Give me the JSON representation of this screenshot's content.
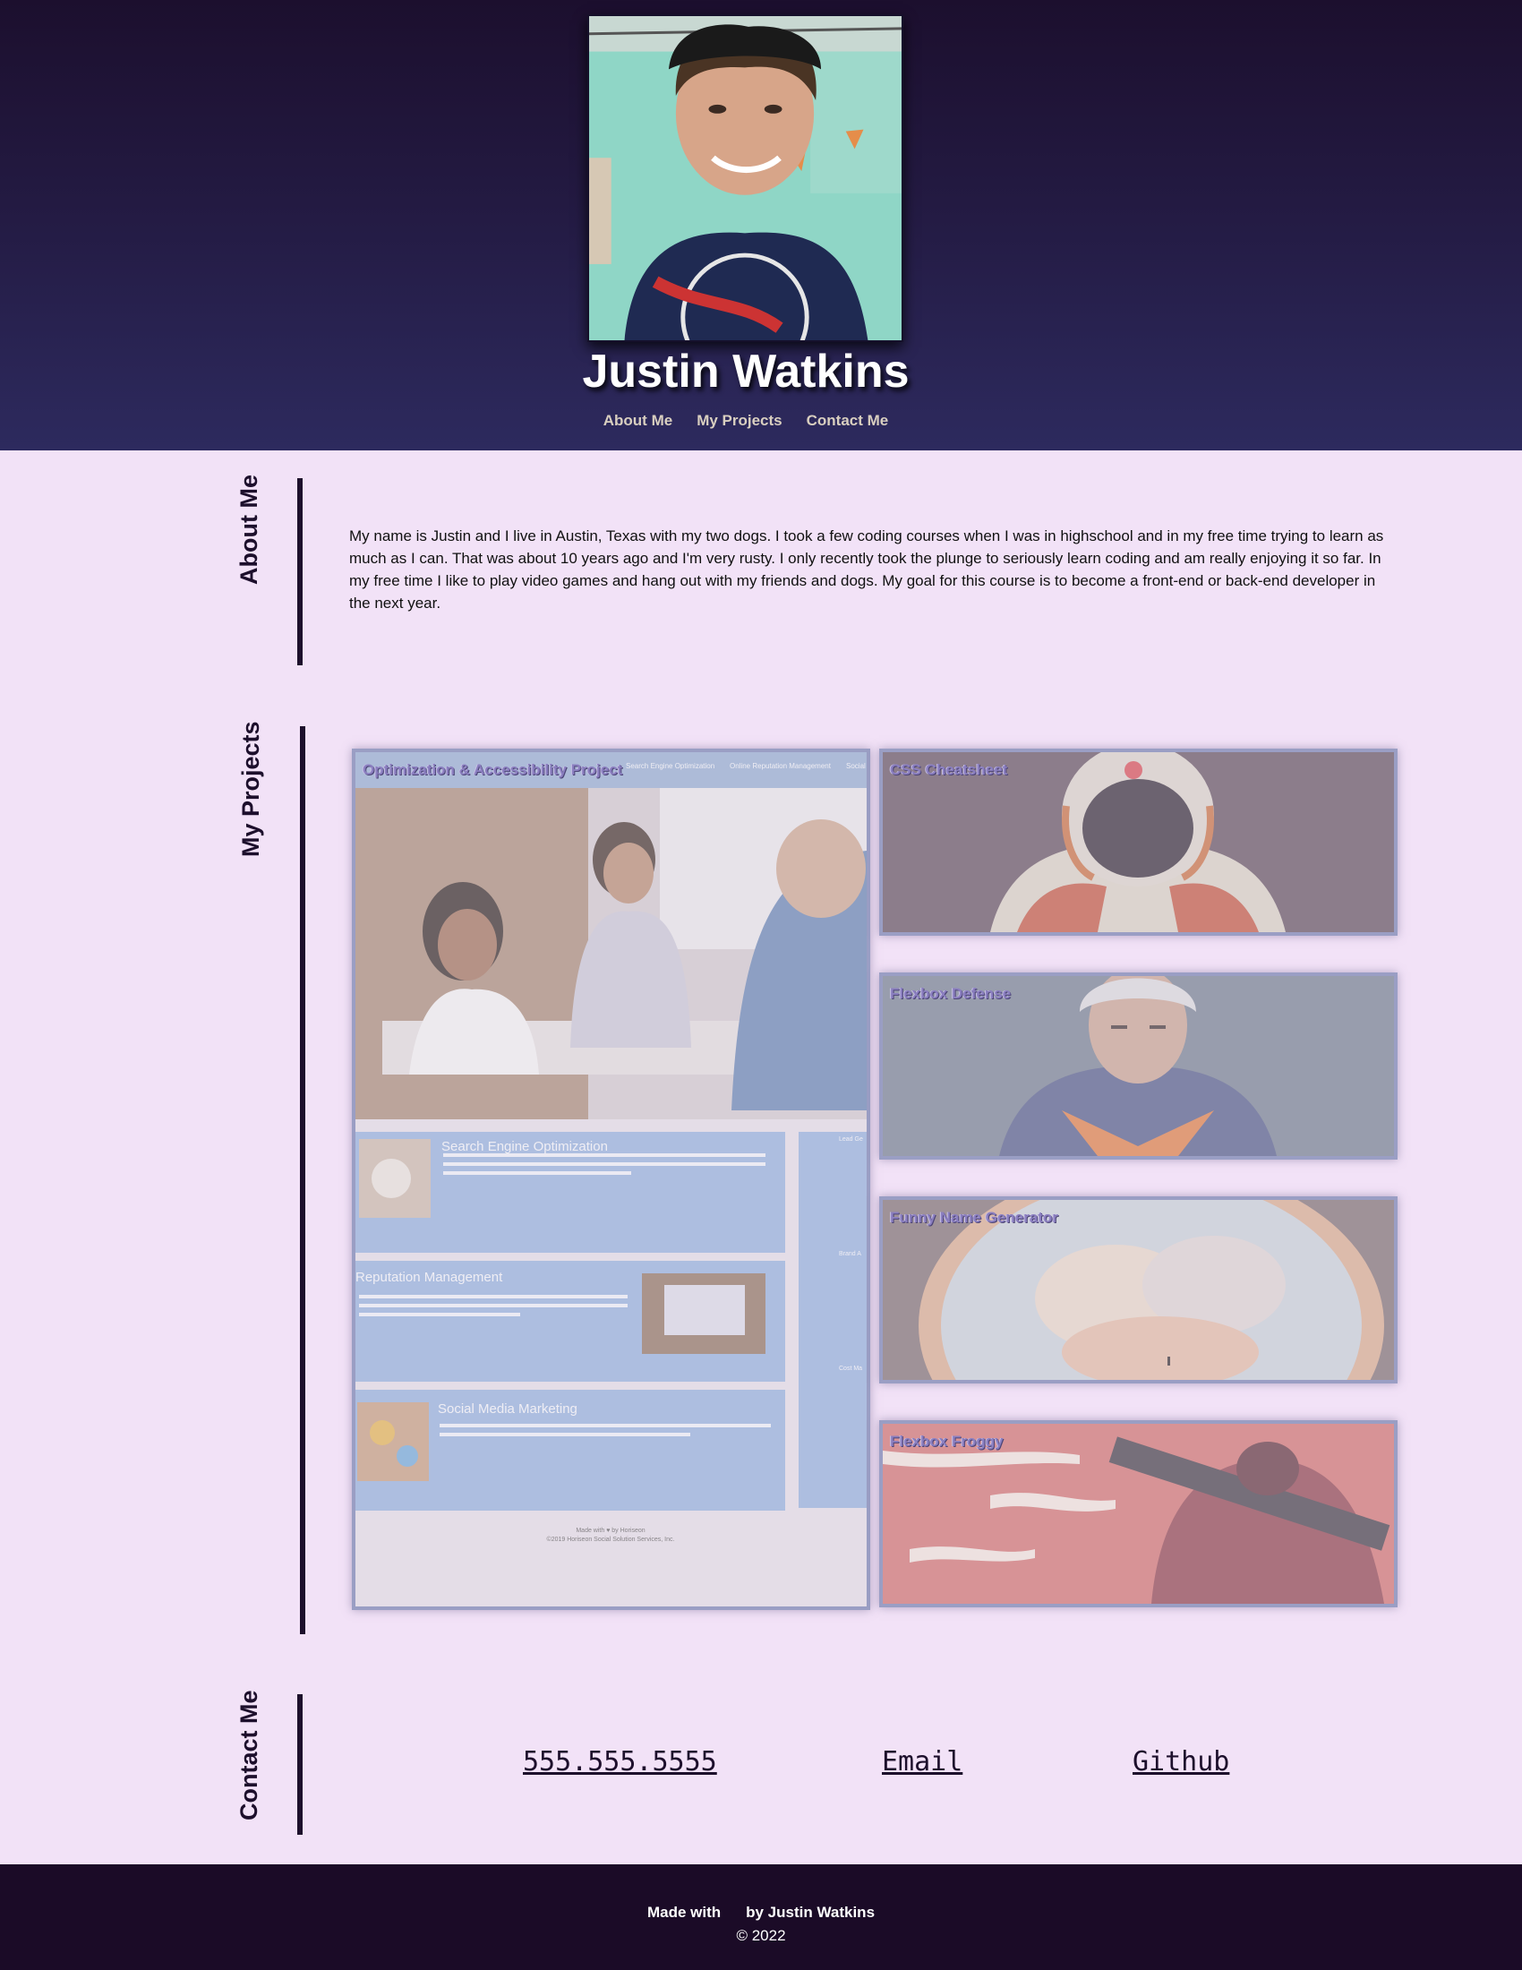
{
  "header": {
    "name": "Justin Watkins",
    "nav": {
      "about": "About Me",
      "projects": "My Projects",
      "contact": "Contact Me"
    }
  },
  "about": {
    "title": "About Me",
    "text": "My name is Justin and I live in Austin, Texas with my two dogs. I took a few coding courses when I was in highschool and in my free time trying to learn as much as I can. That was about 10 years ago and I'm very rusty. I only recently took the plunge to seriously learn coding and am really enjoying it so far. In my free time I like to play video games and hang out with my friends and dogs. My goal for this course is to become a front-end or back-end developer in the next year."
  },
  "projects": {
    "title": "My Projects",
    "featured": {
      "title": "Optimization & Accessibility Project",
      "nav_items": [
        "Search Engine Optimization",
        "Online Reputation Management",
        "Social"
      ],
      "sections": [
        "Search Engine Optimization",
        "Reputation Management",
        "Social Media Marketing"
      ],
      "sidebar_items": [
        "Lead Ge",
        "Brand A",
        "Cost Ma"
      ],
      "footer_line1": "Made with ♥ by Horiseon",
      "footer_line2": "©2019 Horiseon Social Solution Services, Inc."
    },
    "items": [
      {
        "title": "CSS Cheatsheet",
        "theme": "astronaut"
      },
      {
        "title": "Flexbox Defense",
        "theme": "warrior"
      },
      {
        "title": "Funny Name Generator",
        "theme": "portal"
      },
      {
        "title": "Flexbox Froggy",
        "theme": "red-mech"
      }
    ]
  },
  "contact": {
    "title": "Contact Me",
    "phone": "555.555.5555",
    "email": "Email",
    "github": "Github"
  },
  "footer": {
    "made_with": "Made with",
    "by": "by Justin Watkins",
    "copyright": "© 2022"
  },
  "colors": {
    "header_top": "#1c0f2e",
    "header_bottom": "#2d2a5e",
    "page_bg": "#f2e2f7",
    "accent_dark": "#1d0f2c",
    "footer_bg": "#1b0b27",
    "card_border": "#9a9ec4"
  }
}
